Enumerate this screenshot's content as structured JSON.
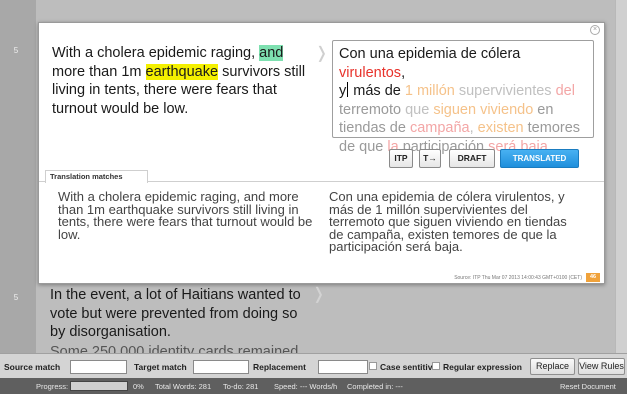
{
  "rows": {
    "row1": "5",
    "row2": "5"
  },
  "segment1": {
    "source": {
      "t1": "With a cholera epidemic raging, ",
      "hl1": "and",
      "t2": " more than 1m ",
      "hl2": "earthquake",
      "t3": " survivors still living in tents, there were fears that turnout would be low."
    },
    "target": {
      "w1": "Con una epidemia de cólera ",
      "w2": "virulentos",
      "w3": ",",
      "w4": "y",
      "w5": " más de ",
      "w6": "1 millón",
      "w7": " supervivientes ",
      "w8": "del",
      "w9": "terremoto",
      "w10": " que ",
      "w11": "siguen viviendo",
      "w12": " en",
      "w13": "tiendas de ",
      "w14": "campaña",
      "w15": ", ",
      "w16": "existen",
      "w17": " temores",
      "w18": "de que ",
      "w19": "la",
      "w20": " participación ",
      "w21": "será baja",
      "w22": "."
    },
    "buttons": {
      "itp": "ITP",
      "t_arrow": "T→",
      "draft": "DRAFT",
      "translated": "TRANSLATED"
    },
    "matches_tab": "Translation matches",
    "match_source": "With a cholera epidemic raging, and more than 1m earthquake survivors still living in tents, there were fears that turnout would be low.",
    "match_target": "Con una epidemia de cólera virulentos, y más de 1 millón supervivientes del terremoto que siguen viviendo en tiendas de campaña, existen temores de que la participación será baja.",
    "source_line": "Source: ITP   Thu Mar 07 2013 14:00:43 GMT+0100 (CET)",
    "score": "46"
  },
  "segment2": {
    "source": "In the event, a lot of Haitians wanted to vote but were prevented from doing so by disorganisation."
  },
  "segment3": {
    "source": "Some 250,000 identity cards remained"
  },
  "searchbar": {
    "source_match": "Source match",
    "target_match": "Target match",
    "replacement": "Replacement",
    "case_sensitive": "Case sentitive",
    "regex": "Regular expression",
    "replace": "Replace",
    "view_rules": "View Rules"
  },
  "statusbar": {
    "progress_label": "Progress:",
    "progress_percent": "0%",
    "progress_value": 0,
    "total_words": "Total Words: 281",
    "todo": "To-do: 281",
    "speed": "Speed: --- Words/h",
    "completed": "Completed in: ---",
    "reset": "Reset Document"
  },
  "colors": {
    "accent_blue": "#2a9ae5",
    "unconfirmed_red": "#e8322b",
    "highlight_yellow": "#f4f000",
    "highlight_green": "#7ee0b0",
    "score_orange": "#f0a23a"
  }
}
